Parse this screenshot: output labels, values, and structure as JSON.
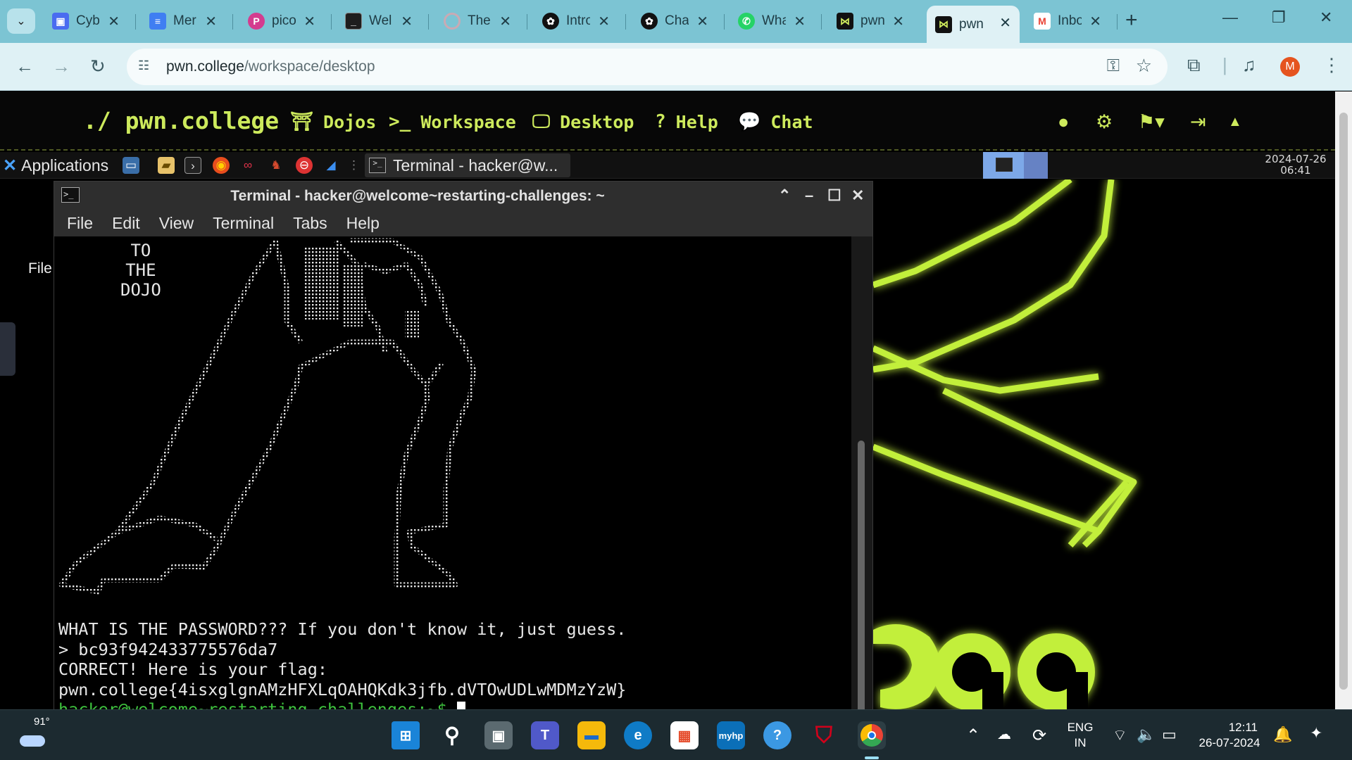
{
  "browser": {
    "tabs": [
      {
        "title": "Cyb",
        "favicon": "blue-square-icon",
        "color": "#4a6cf0"
      },
      {
        "title": "Mer",
        "favicon": "docs-icon",
        "color": "#3f7ef2"
      },
      {
        "title": "pico",
        "favicon": "picoctf-icon",
        "color": "#d43c8f"
      },
      {
        "title": "Wel",
        "favicon": "terminal-icon",
        "color": "#1e1e1e"
      },
      {
        "title": "The",
        "favicon": "loading-icon",
        "color": "#c9aab4"
      },
      {
        "title": "Intro",
        "favicon": "openai-icon",
        "color": "#111111"
      },
      {
        "title": "Cha",
        "favicon": "openai-icon",
        "color": "#111111"
      },
      {
        "title": "Wha",
        "favicon": "whatsapp-icon",
        "color": "#25d366"
      },
      {
        "title": "pwn",
        "favicon": "pwn-college-icon",
        "color": "#111111"
      },
      {
        "title": "pwn",
        "favicon": "pwn-college-icon",
        "color": "#111111",
        "active": true
      },
      {
        "title": "Inbo",
        "favicon": "gmail-icon",
        "color": "#ea4335"
      }
    ],
    "url_host": "pwn.college",
    "url_path": "/workspace/desktop",
    "profile_initial": "M"
  },
  "pwn_nav": {
    "logo": "./ pwn.college",
    "links": [
      {
        "label": "Dojos",
        "icon": "torii-gate-icon"
      },
      {
        "label": "Workspace",
        "icon": "terminal-prompt-icon"
      },
      {
        "label": "Desktop",
        "icon": "monitor-icon"
      },
      {
        "label": "Help",
        "icon": "question-icon"
      },
      {
        "label": "Chat",
        "icon": "chat-bubbles-icon"
      }
    ],
    "accent": "#cdea5c"
  },
  "xfce": {
    "applications_label": "Applications",
    "task_title": "Terminal - hacker@w...",
    "clock_date": "2024-07-26",
    "clock_time": "06:41"
  },
  "desktop": {
    "file_label": "File"
  },
  "terminal": {
    "title": "Terminal - hacker@welcome~restarting-challenges: ~",
    "menu": [
      "File",
      "Edit",
      "View",
      "Terminal",
      "Tabs",
      "Help"
    ],
    "banner": [
      "TO",
      "THE",
      "DOJO"
    ],
    "question": "WHAT IS THE PASSWORD??? If you don't know it, just guess.",
    "input": "> bc93f942433775576da7",
    "correct": "CORRECT! Here is your flag:",
    "flag": "pwn.college{4isxglgnAMzHFXLqOAHQKdk3jfb.dVTOwUDLwMDMzYzW}",
    "prompt": "hacker@welcome~restarting-challenges:~$ "
  },
  "taskbar": {
    "temperature": "91°",
    "lang_top": "ENG",
    "lang_bottom": "IN",
    "time": "12:11",
    "date": "26-07-2024"
  }
}
